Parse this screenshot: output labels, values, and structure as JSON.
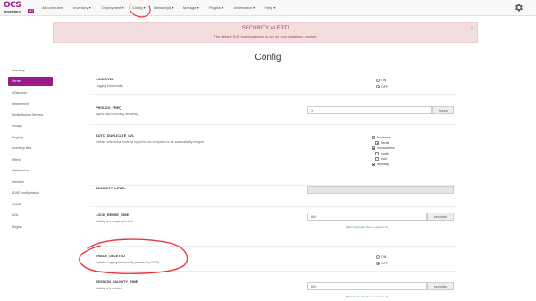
{
  "logo": {
    "mark": "OCS",
    "sub": "inventory",
    "version": "NG"
  },
  "nav": {
    "items": [
      "All computers",
      "Inventory ▾",
      "Deployment ▾",
      "Config ▾",
      "Network(s) ▾",
      "Manage ▾",
      "Plugins ▾",
      "Information ▾",
      "Help ▾"
    ]
  },
  "icons": {
    "settings": "gear-icon",
    "close": "close-icon"
  },
  "alert": {
    "title": "SECURITY ALERT!",
    "message": "The default SQL login/password is set on your database: ocsweb",
    "close": "×"
  },
  "page": {
    "title": "Config"
  },
  "sidebar": {
    "items": [
      "Inventory",
      "Server",
      "IpDiscover",
      "Deployment",
      "Redistribution Servers",
      "Groups",
      "Registry",
      "Inventory files",
      "Filters",
      "Webservice",
      "Interface",
      "LDAP configuration",
      "SNMP",
      "WOL",
      "Plugins"
    ],
    "active": "Server"
  },
  "rows": {
    "loglevel": {
      "name": "LOGLEVEL",
      "desc": "Logging functionality",
      "options": [
        "ON",
        "OFF"
      ],
      "selected": "OFF"
    },
    "prolog_freq": {
      "name": "PROLOG_FREQ",
      "desc": "Agent auto-launching frequency",
      "value": "1",
      "unit": "hours"
    },
    "auto_duplicate": {
      "name": "AUTO_DUPLICATE_LVL",
      "desc": "Defines criteria that must be equal for two computers to be automatically merged",
      "options": [
        {
          "label": "hostname",
          "checked": true
        },
        {
          "label": "Serial",
          "checked": true
        },
        {
          "label": "macaddress",
          "checked": true
        },
        {
          "label": "model",
          "checked": false
        },
        {
          "label": "uuid",
          "checked": false
        },
        {
          "label": "assettag",
          "checked": true
        }
      ]
    },
    "security_level": {
      "name": "SECURITY_LEVEL"
    },
    "lock_reuse": {
      "name": "LOCK_REUSE_TIME",
      "desc": "Validity of a computer's lock",
      "value": "600",
      "unit": "seconds",
      "hint": "(Must be greater than or equal to 1)"
    },
    "trace_deleted": {
      "name": "TRACE_DELETED",
      "desc": "Deletion logging functionality (needed by GLPI)",
      "options": [
        "ON",
        "OFF"
      ],
      "selected": "OFF"
    },
    "session_validity": {
      "name": "SESSION_VALIDITY_TIME",
      "desc": "Validity of a session",
      "value": "600",
      "unit": "seconds",
      "hint": "(Must be greater than or equal to 1)"
    }
  },
  "colors": {
    "brand": "#9b1b8a",
    "alert_bg": "#f2dede",
    "alert_text": "#a94442",
    "annotation": "#e8373a",
    "hint": "#3c9b3c"
  }
}
